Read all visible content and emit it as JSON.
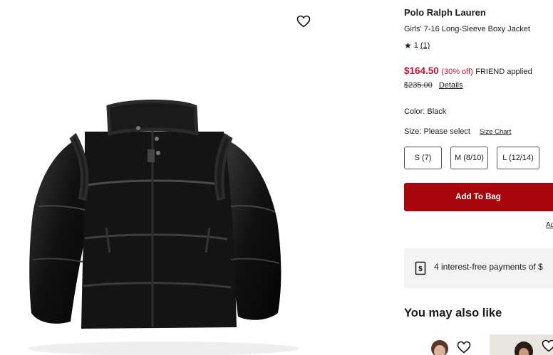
{
  "gallery": {
    "wishlist_icon": "heart-outline-icon",
    "image_alt": "Black puffer jacket with sherpa-trim collar and armholes"
  },
  "product": {
    "brand": "Polo Ralph Lauren",
    "name": "Girls' 7-16 Long-Sleeve Boxy Jacket",
    "rating_icon": "star-icon",
    "rating_value": "1",
    "rating_count": "(1)",
    "sale_price": "$164.50",
    "discount": "(30% off)",
    "promo": "FRIEND applied",
    "original_price": "$235.00",
    "details_label": "Details",
    "color_label": "Color: Black",
    "size_label": "Size: Please select",
    "size_chart_label": "Size Chart",
    "sizes": [
      "S (7)",
      "M (8/10)",
      "L (12/14)"
    ],
    "add_to_bag_label": "Add To Bag",
    "add_link_label": "Ad",
    "payment_icon": "dollar-tag-icon",
    "payment_text": "4 interest-free payments of $",
    "recommendations_title": "You may also like"
  },
  "colors": {
    "sale": "#c8102e",
    "add_to_bag": "#a8060d",
    "payment_bg": "#f3f3f3"
  }
}
